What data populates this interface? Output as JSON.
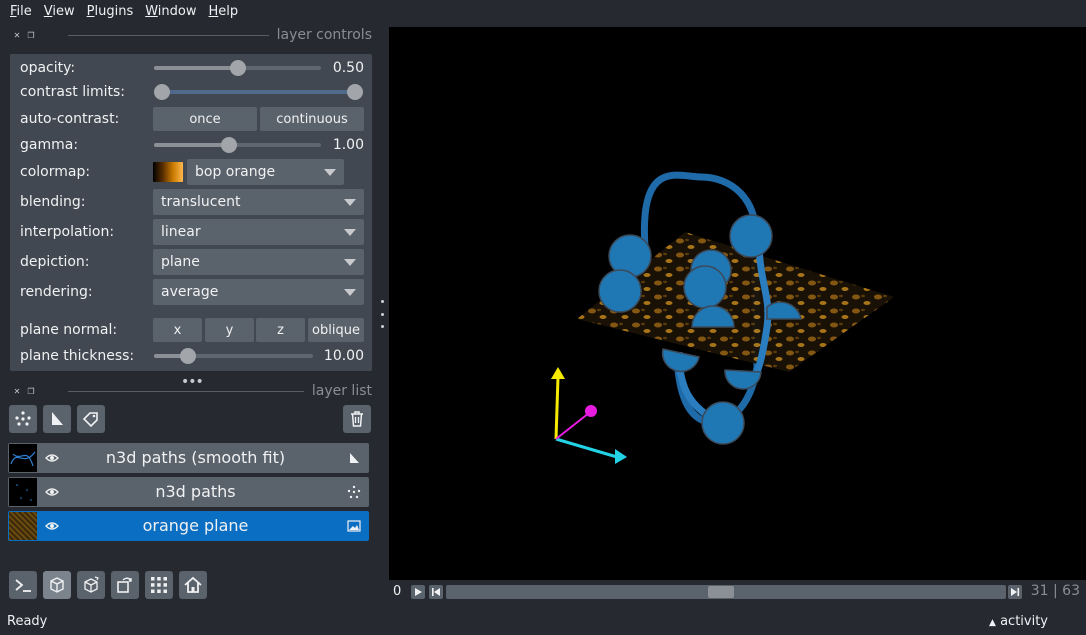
{
  "menu": [
    {
      "mnemonic": "F",
      "rest": "ile"
    },
    {
      "mnemonic": "V",
      "rest": "iew"
    },
    {
      "mnemonic": "P",
      "rest": "lugins"
    },
    {
      "mnemonic": "W",
      "rest": "indow"
    },
    {
      "mnemonic": "H",
      "rest": "elp"
    }
  ],
  "layer_controls": {
    "title": "layer controls",
    "opacity": {
      "label": "opacity:",
      "value": "0.50",
      "level": 0.5
    },
    "contrast_limits": {
      "label": "contrast limits:",
      "low": 0.0,
      "high": 1.0
    },
    "auto_contrast": {
      "label": "auto-contrast:",
      "once": "once",
      "continuous": "continuous"
    },
    "gamma": {
      "label": "gamma:",
      "value": "1.00",
      "level": 0.45
    },
    "colormap": {
      "label": "colormap:",
      "value": "bop orange"
    },
    "blending": {
      "label": "blending:",
      "value": "translucent"
    },
    "interpolation": {
      "label": "interpolation:",
      "value": "linear"
    },
    "depiction": {
      "label": "depiction:",
      "value": "plane"
    },
    "rendering": {
      "label": "rendering:",
      "value": "average"
    },
    "plane_normal": {
      "label": "plane normal:",
      "x": "x",
      "y": "y",
      "z": "z",
      "oblique": "oblique"
    },
    "plane_thickness": {
      "label": "plane thickness:",
      "value": "10.00",
      "level": 0.2
    }
  },
  "layer_list": {
    "title": "layer list",
    "layers": [
      {
        "name": "n3d paths (smooth fit)",
        "type_icon": "shapes-icon",
        "selected": false
      },
      {
        "name": "n3d paths",
        "type_icon": "points-icon",
        "selected": false
      },
      {
        "name": "orange plane",
        "type_icon": "image-icon",
        "selected": true
      }
    ]
  },
  "dims": {
    "index": "0",
    "current": "31",
    "total": "63",
    "position": 0.49
  },
  "status": {
    "text": "Ready",
    "activity": "activity"
  },
  "colors": {
    "accent": "#0a6fc3",
    "panel": "#414851",
    "background": "#262930",
    "button": "#5a626c"
  }
}
